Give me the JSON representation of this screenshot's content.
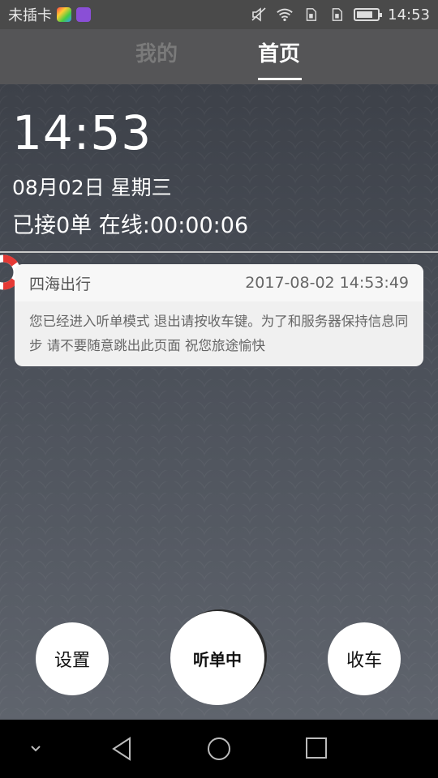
{
  "status_bar": {
    "carrier": "未插卡",
    "time": "14:53",
    "battery_level": 0.8,
    "icons": [
      "photo-app-icon",
      "purple-app-icon",
      "mute-icon",
      "wifi-icon",
      "sim-icon",
      "sim-icon",
      "battery-icon"
    ]
  },
  "tabs": {
    "mine": "我的",
    "home": "首页"
  },
  "dashboard": {
    "clock": "14:53",
    "date": "08月02日 星期三",
    "orders": "已接0单 在线:00:00:06"
  },
  "message": {
    "sender": "四海出行",
    "timestamp": "2017-08-02 14:53:49",
    "body": "您已经进入听单模式 退出请按收车键。为了和服务器保持信息同步 请不要随意跳出此页面 祝您旅途愉快"
  },
  "buttons": {
    "settings": "设置",
    "listening": "听单中",
    "park": "收车"
  },
  "nav": {
    "icons": [
      "chevron-down-icon",
      "back-icon",
      "home-icon",
      "recents-icon"
    ]
  }
}
